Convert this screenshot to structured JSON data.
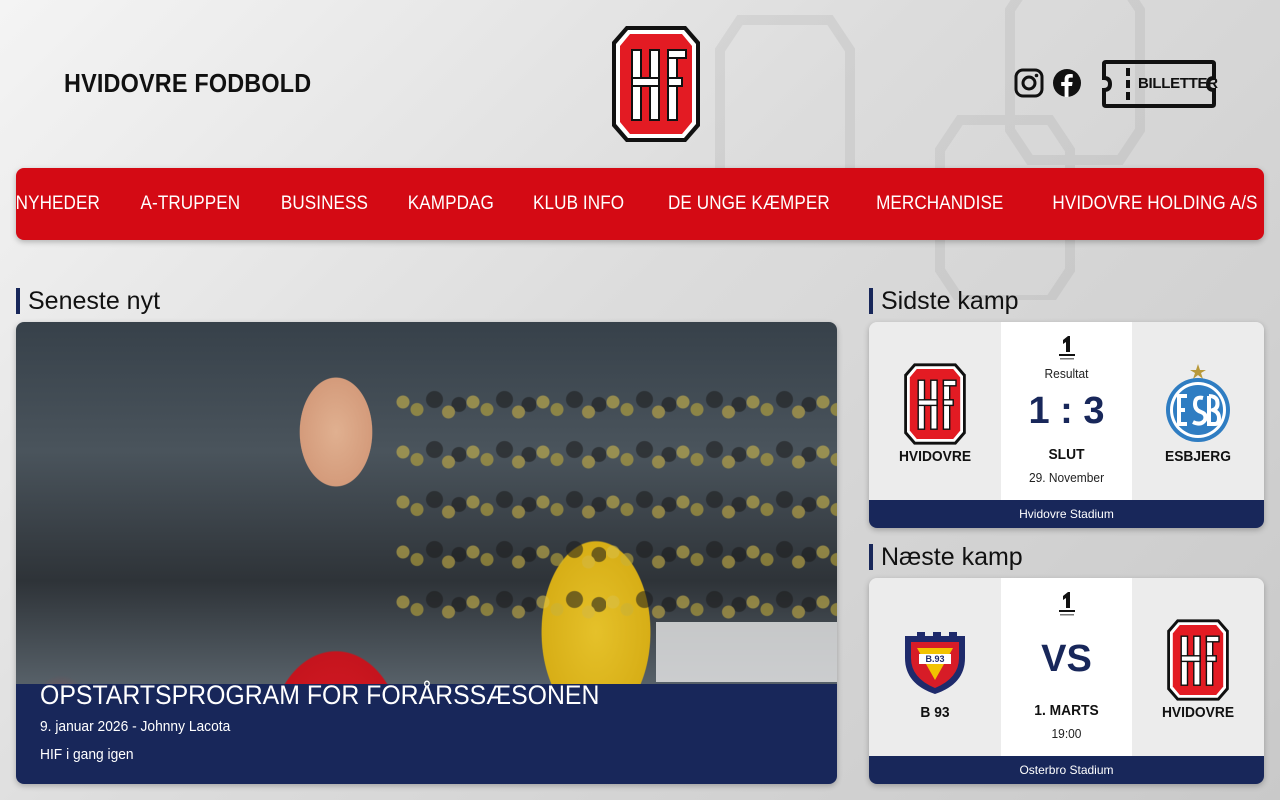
{
  "header": {
    "site_title": "HVIDOVRE FODBOLD",
    "ticket_label": "BILLETTER",
    "social": [
      "instagram-icon",
      "facebook-icon"
    ]
  },
  "nav": {
    "items": [
      {
        "label": "NYHEDER"
      },
      {
        "label": "A-TRUPPEN"
      },
      {
        "label": "BUSINESS"
      },
      {
        "label": "KAMPDAG"
      },
      {
        "label": "KLUB INFO"
      },
      {
        "label": "DE UNGE KÆMPER"
      },
      {
        "label": "MERCHANDISE"
      },
      {
        "label": "HVIDOVRE HOLDING A/S"
      }
    ]
  },
  "latest_news": {
    "section_title": "Seneste nyt",
    "article": {
      "headline": "OPSTARTSPROGRAM FOR FORÅRSSÆSONEN",
      "meta": "9. januar 2026 - Johnny Lacota",
      "subtitle": "HIF i gang igen"
    }
  },
  "last_match": {
    "section_title": "Sidste kamp",
    "label": "Resultat",
    "home": {
      "name": "HVIDOVRE"
    },
    "away": {
      "name": "ESBJERG"
    },
    "score": "1 : 3",
    "status": "SLUT",
    "date": "29. November",
    "venue": "Hvidovre Stadium"
  },
  "next_match": {
    "section_title": "Næste kamp",
    "home": {
      "name": "B 93"
    },
    "away": {
      "name": "HVIDOVRE"
    },
    "vs": "VS",
    "date": "1. MARTS",
    "time": "19:00",
    "venue": "Osterbro Stadium"
  },
  "colors": {
    "brand_red": "#d40a14",
    "navy": "#18275a",
    "esbjerg_blue": "#2f7dc2"
  }
}
